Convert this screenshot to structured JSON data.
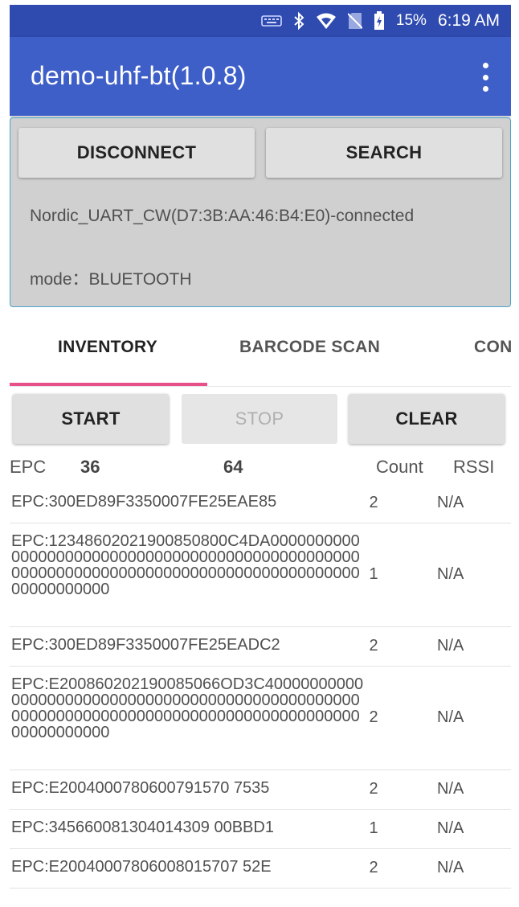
{
  "status_bar": {
    "icons": [
      "keyboard-icon",
      "bluetooth-icon",
      "wifi-icon",
      "no-sim-icon",
      "battery-charging-icon"
    ],
    "battery": "15%",
    "time": "6:19 AM"
  },
  "app_bar": {
    "title": "demo-uhf-bt(1.0.8)",
    "menu_icon": "more-vert-icon"
  },
  "connection": {
    "disconnect_label": "DISCONNECT",
    "search_label": "SEARCH",
    "device": "Nordic_UART_CW(D7:3B:AA:46:B4:E0)-connected",
    "mode": "mode：BLUETOOTH"
  },
  "tabs": [
    {
      "label": "INVENTORY",
      "active": true
    },
    {
      "label": "BARCODE SCAN",
      "active": false
    },
    {
      "label": "CON",
      "active": false
    }
  ],
  "actions": {
    "start_label": "START",
    "stop_label": "STOP",
    "clear_label": "CLEAR"
  },
  "list_header": {
    "epc": "EPC",
    "unique": "36",
    "total": "64",
    "count": "Count",
    "rssi": "RSSI"
  },
  "rows": [
    {
      "epc": "EPC:300ED89F3350007FE25EAE85",
      "count": "2",
      "rssi": "N/A"
    },
    {
      "epc": "EPC:12348602021900850800C4DA000000000000000000000000000000000000000000000000000000000000000000000000000000000000000000000000000",
      "count": "1",
      "rssi": "N/A"
    },
    {
      "epc": "EPC:300ED89F3350007FE25EADC2",
      "count": "2",
      "rssi": "N/A"
    },
    {
      "epc": "EPC:E200860202190085066OD3C4000000000000000000000000000000000000000000000000000000000000000000000000000000000000000000000000000",
      "count": "2",
      "rssi": "N/A"
    },
    {
      "epc": "EPC:E2004000780600791570 7535",
      "count": "2",
      "rssi": "N/A"
    },
    {
      "epc": "EPC:345660081304014309 00BBD1",
      "count": "1",
      "rssi": "N/A"
    },
    {
      "epc": "EPC:E20040007806008015707 52E",
      "count": "2",
      "rssi": "N/A"
    }
  ],
  "colors": {
    "status_bar": "#2f4bb0",
    "app_bar": "#3f5fc8",
    "tab_indicator": "#e8508a",
    "panel": "#d0d0d0"
  }
}
